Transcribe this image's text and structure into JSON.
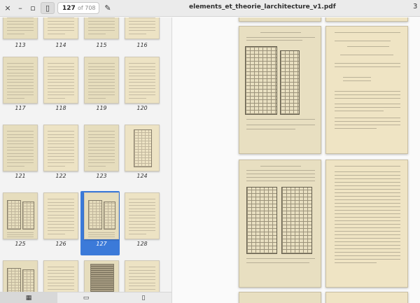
{
  "window": {
    "title": "elements_et_theorie_larchitecture_v1.pdf",
    "current_page": "127",
    "page_total": "of 708",
    "partial_right_glyph": "3"
  },
  "icons": {
    "close": "×",
    "minimize": "–",
    "maximize": "▫",
    "sidebar_toggle": "▯",
    "annotate": "✎",
    "thumbnails_tab": "▦",
    "annotations_tab": "▭",
    "bookmarks_tab": "▯"
  },
  "colors": {
    "accent": "#3b7ad9",
    "paper": "#e9e0c2"
  },
  "thumbnails": [
    {
      "label": "113",
      "kind": "text"
    },
    {
      "label": "114",
      "kind": "text"
    },
    {
      "label": "115",
      "kind": "text"
    },
    {
      "label": "116",
      "kind": "text"
    },
    {
      "label": "117",
      "kind": "text"
    },
    {
      "label": "118",
      "kind": "text"
    },
    {
      "label": "119",
      "kind": "text"
    },
    {
      "label": "120",
      "kind": "text"
    },
    {
      "label": "121",
      "kind": "text"
    },
    {
      "label": "122",
      "kind": "text"
    },
    {
      "label": "123",
      "kind": "text"
    },
    {
      "label": "124",
      "kind": "plan"
    },
    {
      "label": "125",
      "kind": "figure"
    },
    {
      "label": "126",
      "kind": "text"
    },
    {
      "label": "127",
      "kind": "figure",
      "selected": true
    },
    {
      "label": "128",
      "kind": "text"
    },
    {
      "label": "",
      "kind": "figure"
    },
    {
      "label": "",
      "kind": "text"
    },
    {
      "label": "",
      "kind": "building"
    },
    {
      "label": "",
      "kind": "text"
    }
  ],
  "bottom_tabs": [
    {
      "name": "thumbnails",
      "active": true
    },
    {
      "name": "annotations",
      "active": false
    },
    {
      "name": "bookmarks",
      "active": false
    }
  ]
}
